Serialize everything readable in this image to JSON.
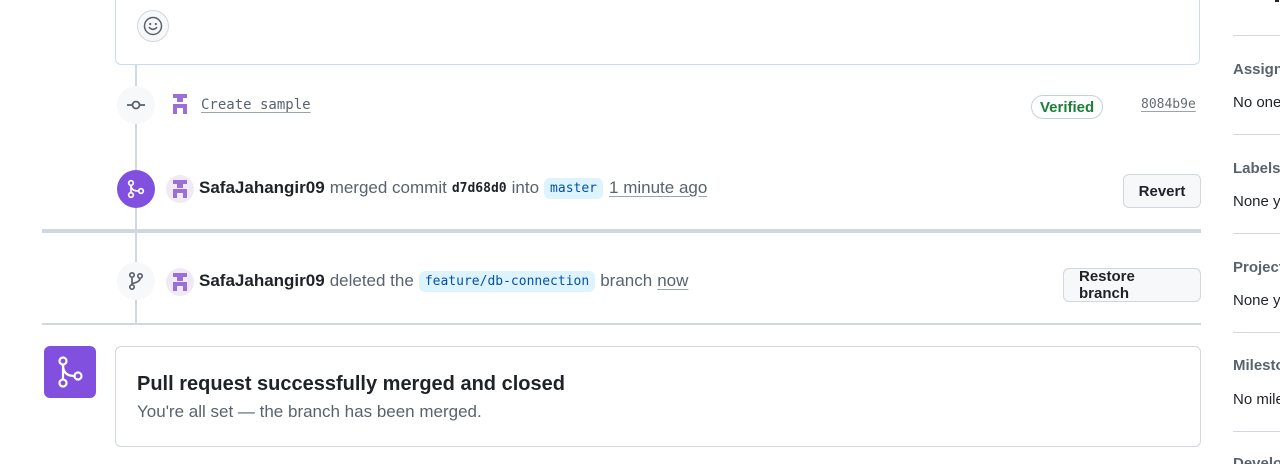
{
  "timeline": {
    "commit": {
      "message": "Create sample",
      "verified_label": "Verified",
      "sha": "8084b9e"
    },
    "merge_event": {
      "user": "SafaJahangir09",
      "action": "merged commit",
      "commit_sha": "d7d68d0",
      "into_word": "into",
      "target_branch": "master",
      "time": "1 minute ago",
      "revert_label": "Revert"
    },
    "delete_event": {
      "user": "SafaJahangir09",
      "action": "deleted the",
      "branch": "feature/db-connection",
      "branch_word": "branch",
      "time": "now",
      "restore_label": "Restore branch"
    },
    "merged_notice": {
      "title": "Pull request successfully merged and closed",
      "subtitle": "You're all set — the branch has been merged."
    }
  },
  "sidebar": {
    "assignees": {
      "title": "Assignees",
      "value": "No one—"
    },
    "labels": {
      "title": "Labels",
      "value": "None yet"
    },
    "projects": {
      "title": "Projects",
      "value": "None yet"
    },
    "milestone": {
      "title": "Milestone",
      "value": "No milestone"
    },
    "development": {
      "title": "Development"
    }
  },
  "colors": {
    "merged_purple": "#8250df",
    "verified_green": "#1a7f37",
    "branch_pill_bg": "#ddf4ff"
  },
  "icons": [
    "smiley-icon",
    "git-commit-icon",
    "git-merge-icon",
    "git-branch-icon"
  ]
}
